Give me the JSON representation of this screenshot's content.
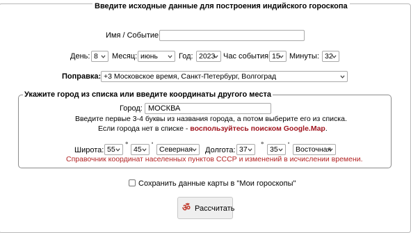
{
  "legend_main": "Введите исходные данные для построения индийского гороскопа",
  "name_label": "Имя / Событие:",
  "name_value": "",
  "day_label": "День:",
  "day_value": "8",
  "month_label": "Месяц:",
  "month_value": "июнь",
  "year_label": "Год:",
  "year_value": "2023",
  "hour_label": "Час события:",
  "hour_value": "15",
  "minute_label": "Минуты:",
  "minute_value": "32",
  "correction_label": "Поправка:",
  "correction_value": "+3 Московское время, Санкт-Петербург, Волгоград",
  "legend_city": "Укажите город из списка или введите координаты другого места",
  "city_label": "Город:",
  "city_value": "МОСКВА",
  "hint_line1": "Введите первые 3-4 буквы из названия города, а потом выберите его из списка.",
  "hint_line2_prefix": "Если города нет в списке - ",
  "hint_line2_link": "воспользуйтесь поиском Google.Map",
  "hint_line2_suffix": ".",
  "lat_label": "Широта:",
  "lat_deg": "55",
  "lat_min": "45",
  "lat_dir": "Северная",
  "lon_label": "Долгота:",
  "lon_deg": "37",
  "lon_min": "35",
  "lon_dir": "Восточная",
  "deg_symbol": "°",
  "min_symbol": "'",
  "reference_link": "Справочник координат населенных пунктов СССР и изменений в исчислении времени.",
  "save_label": "Сохранить данные карты в \"Мои гороскопы\"",
  "save_checked": false,
  "calc_button": "Рассчитать",
  "calc_icon": "om-icon",
  "colors": {
    "link_red": "#b22222",
    "border": "#a9a9a9"
  }
}
